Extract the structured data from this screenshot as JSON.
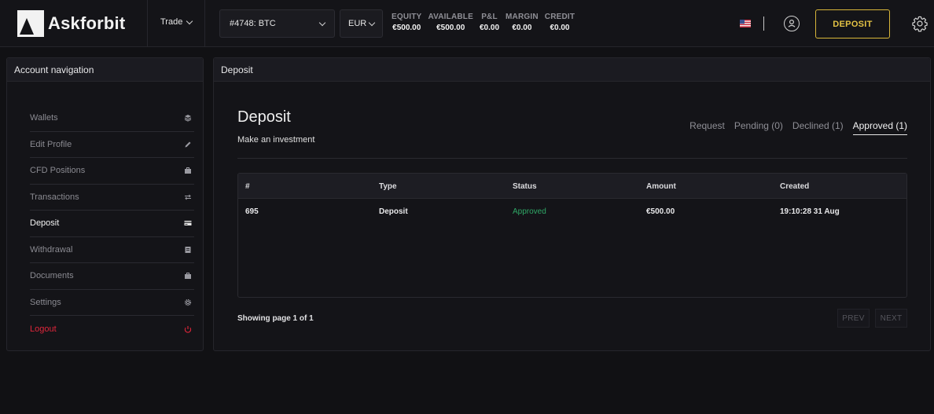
{
  "header": {
    "brand": "Askforbit",
    "trade_label": "Trade",
    "account_select": "#4748: BTC",
    "currency_select": "EUR",
    "stats": [
      {
        "label": "EQUITY",
        "value": "€500.00"
      },
      {
        "label": "AVAILABLE",
        "value": "€500.00"
      },
      {
        "label": "P&L",
        "value": "€0.00"
      },
      {
        "label": "MARGIN",
        "value": "€0.00"
      },
      {
        "label": "CREDIT",
        "value": "€0.00"
      }
    ],
    "deposit_label": "DEPOSIT",
    "icons": {
      "flag": "us-flag-icon",
      "user": "user-icon",
      "settings": "gear-icon"
    }
  },
  "nav": {
    "title": "Account navigation",
    "items": [
      {
        "label": "Wallets",
        "icon": "layers-icon"
      },
      {
        "label": "Edit Profile",
        "icon": "pencil-icon"
      },
      {
        "label": "CFD Positions",
        "icon": "briefcase-icon"
      },
      {
        "label": "Transactions",
        "icon": "exchange-icon"
      },
      {
        "label": "Deposit",
        "icon": "credit-card-icon",
        "active": true
      },
      {
        "label": "Withdrawal",
        "icon": "document-icon"
      },
      {
        "label": "Documents",
        "icon": "briefcase-icon"
      },
      {
        "label": "Settings",
        "icon": "gear-icon"
      },
      {
        "label": "Logout",
        "icon": "power-icon"
      }
    ]
  },
  "main": {
    "panel_title": "Deposit",
    "title": "Deposit",
    "subtitle": "Make an investment",
    "tabs": [
      {
        "label": "Request"
      },
      {
        "label": "Pending (0)"
      },
      {
        "label": "Declined (1)"
      },
      {
        "label": "Approved (1)",
        "active": true
      }
    ],
    "table": {
      "columns": [
        "#",
        "Type",
        "Status",
        "Amount",
        "Created"
      ],
      "rows": [
        [
          "695",
          "Deposit",
          "Approved",
          "€500.00",
          "19:10:28 31 Aug"
        ]
      ]
    },
    "showing": "Showing page 1 of 1",
    "prev_label": "PREV",
    "next_label": "NEXT"
  },
  "colors": {
    "accent": "#e3c244",
    "approved": "#2fa866",
    "logout": "#e0263b",
    "background": "#111114"
  }
}
